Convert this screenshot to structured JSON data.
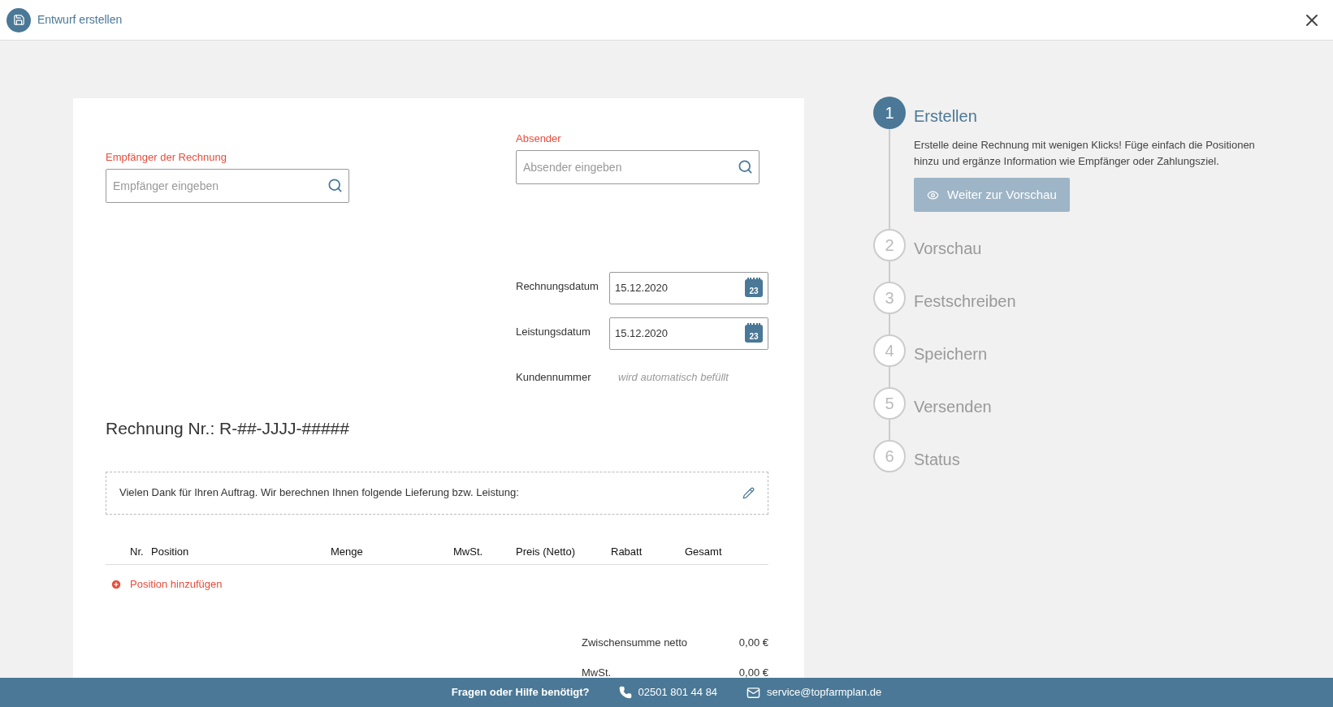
{
  "header": {
    "title": "Entwurf erstellen"
  },
  "recipient": {
    "label": "Empfänger der Rechnung",
    "placeholder": "Empfänger eingeben"
  },
  "sender": {
    "label": "Absender",
    "placeholder": "Absender eingeben"
  },
  "dates": [
    {
      "label": "Rechnungsdatum",
      "value": "15.12.2020",
      "icon_text": "23"
    },
    {
      "label": "Leistungsdatum",
      "value": "15.12.2020",
      "icon_text": "23"
    }
  ],
  "customer_number": {
    "label": "Kundennummer",
    "value": "wird automatisch befüllt"
  },
  "invoice_title": "Rechnung Nr.: R-##-JJJJ-#####",
  "intro_text": "Vielen Dank für Ihren Auftrag. Wir berechnen Ihnen folgende Lieferung bzw. Leistung:",
  "table": {
    "columns": [
      "Nr.",
      "Position",
      "Menge",
      "MwSt.",
      "Preis (Netto)",
      "Rabatt",
      "Gesamt"
    ]
  },
  "add_position": "Position hinzufügen",
  "totals": [
    {
      "label": "Zwischensumme netto",
      "value": "0,00 €"
    },
    {
      "label": "MwSt.",
      "value": "0,00 €"
    }
  ],
  "steps": [
    {
      "number": "1",
      "label": "Erstellen",
      "selected": true,
      "description": "Erstelle deine Rechnung mit wenigen Klicks! Füge einfach die Positionen hinzu und ergänze Information wie Empfänger oder Zahlungsziel.",
      "button": {
        "label": "Weiter zur Vorschau",
        "disabled": true
      }
    },
    {
      "number": "2",
      "label": "Vorschau",
      "selected": false
    },
    {
      "number": "3",
      "label": "Festschreiben",
      "selected": false
    },
    {
      "number": "4",
      "label": "Speichern",
      "selected": false
    },
    {
      "number": "5",
      "label": "Versenden",
      "selected": false
    },
    {
      "number": "6",
      "label": "Status",
      "selected": false
    }
  ],
  "footer": {
    "help": "Fragen oder Hilfe benötigt?",
    "phone": "02501 801 44 84",
    "email": "service@topfarmplan.de"
  }
}
